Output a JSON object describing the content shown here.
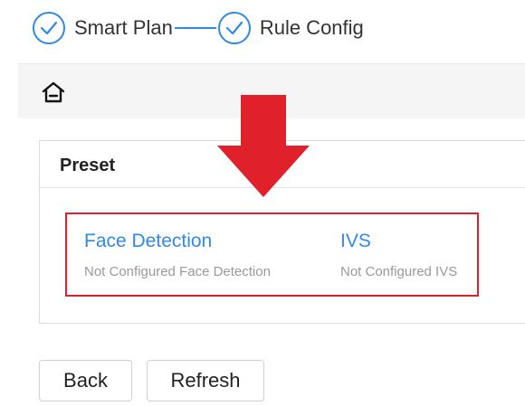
{
  "stepper": {
    "steps": [
      {
        "label": "Smart Plan",
        "state": "completed"
      },
      {
        "label": "Rule Config",
        "state": "completed"
      }
    ],
    "accent_color": "#2f8ae6"
  },
  "toolbar": {
    "home_icon": "home-icon"
  },
  "preset": {
    "title": "Preset",
    "plans": [
      {
        "title": "Face Detection",
        "description": "Not Configured Face Detection"
      },
      {
        "title": "IVS",
        "description": "Not Configured IVS"
      }
    ]
  },
  "annotation": {
    "arrow_color": "#e0202a",
    "box_color": "#e0202a"
  },
  "buttons": {
    "back": "Back",
    "refresh": "Refresh"
  }
}
